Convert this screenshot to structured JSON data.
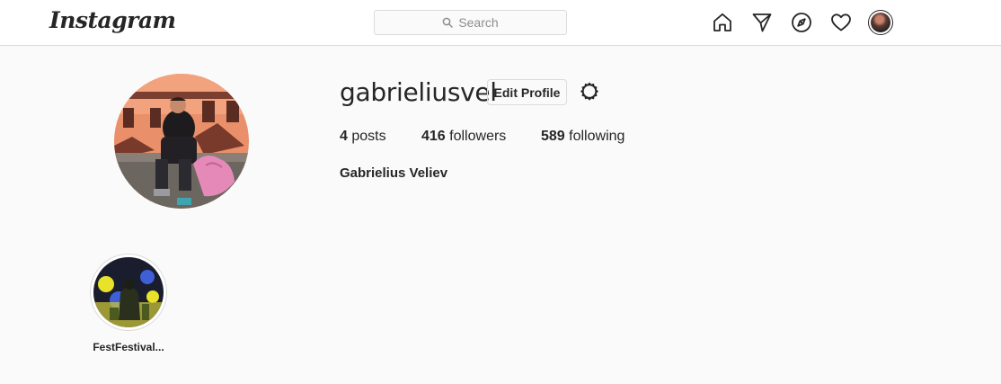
{
  "header": {
    "logo": "Instagram",
    "search": {
      "placeholder": "Search"
    },
    "nav": [
      "home-icon",
      "direct-icon",
      "explore-icon",
      "activity-icon",
      "profile-avatar"
    ]
  },
  "profile": {
    "username": "gabrieliusvel",
    "edit_label": "Edit Profile",
    "stats": {
      "posts": {
        "value": "4",
        "label": "posts"
      },
      "followers": {
        "value": "416",
        "label": "followers"
      },
      "following": {
        "value": "589",
        "label": "following"
      }
    },
    "full_name": "Gabrielius Veliev"
  },
  "highlights": [
    {
      "label": "FestFestival..."
    }
  ],
  "colors": {
    "background": "#fafafa",
    "header_bg": "#ffffff",
    "border": "#dbdbdb",
    "text": "#262626",
    "muted": "#8e8e8e"
  }
}
